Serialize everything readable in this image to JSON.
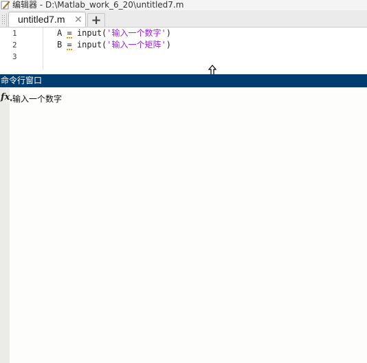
{
  "window": {
    "title": "编辑器 - D:\\Matlab_work_6_20\\untitled7.m"
  },
  "tabs": {
    "active_label": "untitled7.m",
    "close_glyph": "✕",
    "add_glyph": "+"
  },
  "editor": {
    "line_numbers": [
      "1",
      "2",
      "3"
    ],
    "lines": [
      {
        "var": "A",
        "op": "=",
        "func": "input(",
        "str": "'输入一个数字'",
        "close": ")"
      },
      {
        "var": "B",
        "op": "=",
        "func": "input(",
        "str": "'输入一个矩阵'",
        "close": ")"
      }
    ]
  },
  "command_window": {
    "title": "命令行窗口",
    "prompt_icon": "fx",
    "output_text": "输入一个数字"
  },
  "icons": {
    "title_icon": "pen-edit-icon",
    "cursor": "vertical-resize-cursor-icon"
  },
  "colors": {
    "header_bg": "#003c70",
    "string": "#a020f0",
    "warning_underline": "#e5a000"
  }
}
